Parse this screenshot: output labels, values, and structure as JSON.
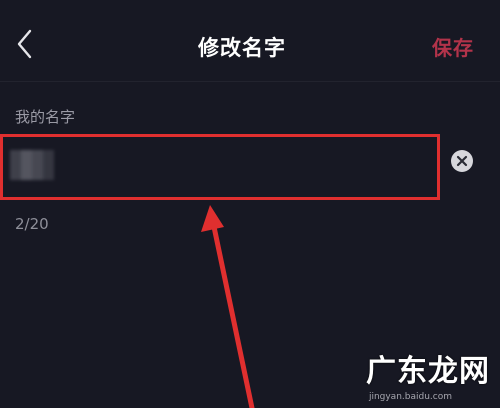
{
  "header": {
    "title": "修改名字",
    "save_label": "保存"
  },
  "form": {
    "label": "我的名字",
    "char_count": "2/20"
  },
  "watermark": {
    "text": "广东龙网",
    "url": "jingyan.baidu.com"
  },
  "colors": {
    "background": "#171823",
    "accent": "#b2334a",
    "highlight": "#e02f2f"
  }
}
